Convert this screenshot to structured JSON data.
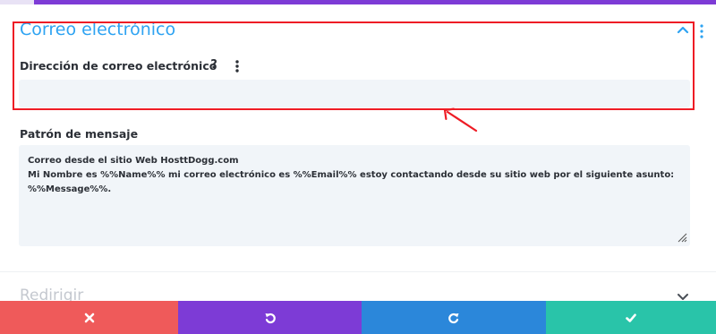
{
  "section": {
    "title": "Correo electrónico"
  },
  "email_field": {
    "label": "Dirección de correo electrónico",
    "help_glyph": "?",
    "value": ""
  },
  "pattern_field": {
    "label": "Patrón de mensaje",
    "lines": [
      "Correo desde el sitio Web HosttDogg.com",
      "Mi Nombre es %%Name%% mi correo electrónico es %%Email%% estoy contactando desde su sitio web por el siguiente asunto:",
      "%%Message%%."
    ]
  },
  "redirect": {
    "title": "Redirigir"
  },
  "actionbar": {
    "buttons": [
      {
        "name": "cancel",
        "icon": "close-icon",
        "color": "#ef5a5a"
      },
      {
        "name": "undo",
        "icon": "undo-icon",
        "color": "#7d3bd6"
      },
      {
        "name": "redo",
        "icon": "redo-icon",
        "color": "#2b87da"
      },
      {
        "name": "save",
        "icon": "check-icon",
        "color": "#29c4a9"
      }
    ]
  },
  "colors": {
    "accent": "#2ea3f2",
    "highlight": "#ee1c25",
    "topbar": "#7d3bd6"
  }
}
